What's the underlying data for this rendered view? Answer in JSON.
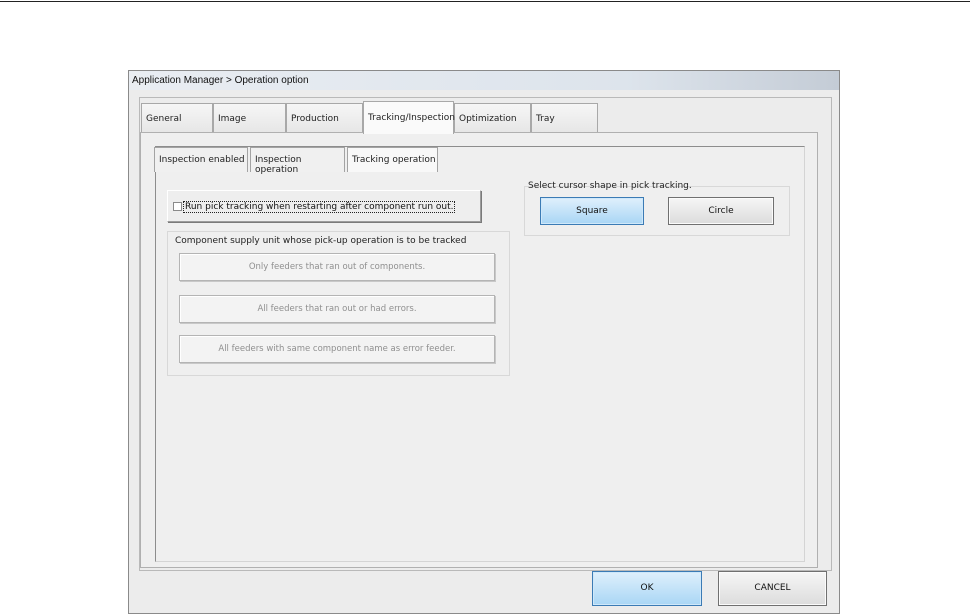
{
  "window": {
    "title": "Application Manager > Operation option"
  },
  "tabs": [
    {
      "label": "General"
    },
    {
      "label": "Image"
    },
    {
      "label": "Production"
    },
    {
      "label": "Tracking/Inspection"
    },
    {
      "label": "Optimization"
    },
    {
      "label": "Tray"
    }
  ],
  "active_tab": "Tracking/Inspection",
  "subtabs": [
    {
      "label": "Inspection enabled"
    },
    {
      "label": "Inspection operation"
    },
    {
      "label": "Tracking operation"
    }
  ],
  "active_subtab": "Tracking operation",
  "tracking": {
    "checkbox_label": "Run pick tracking when restarting after component run out.",
    "checkbox_checked": false,
    "supply_group_title": "Component supply unit whose pick-up operation is to be tracked",
    "supply_options": [
      "Only feeders that ran out of components.",
      "All feeders that ran out or had errors.",
      "All feeders with same component name as error feeder."
    ],
    "cursor_group_title": "Select cursor shape in pick tracking.",
    "cursor_square": "Square",
    "cursor_circle": "Circle",
    "cursor_selected": "Square"
  },
  "footer": {
    "ok_label": "OK",
    "cancel_label": "CANCEL"
  },
  "colors": {
    "selected_button": "#a9d6f5",
    "selected_border": "#3b7bb5"
  }
}
